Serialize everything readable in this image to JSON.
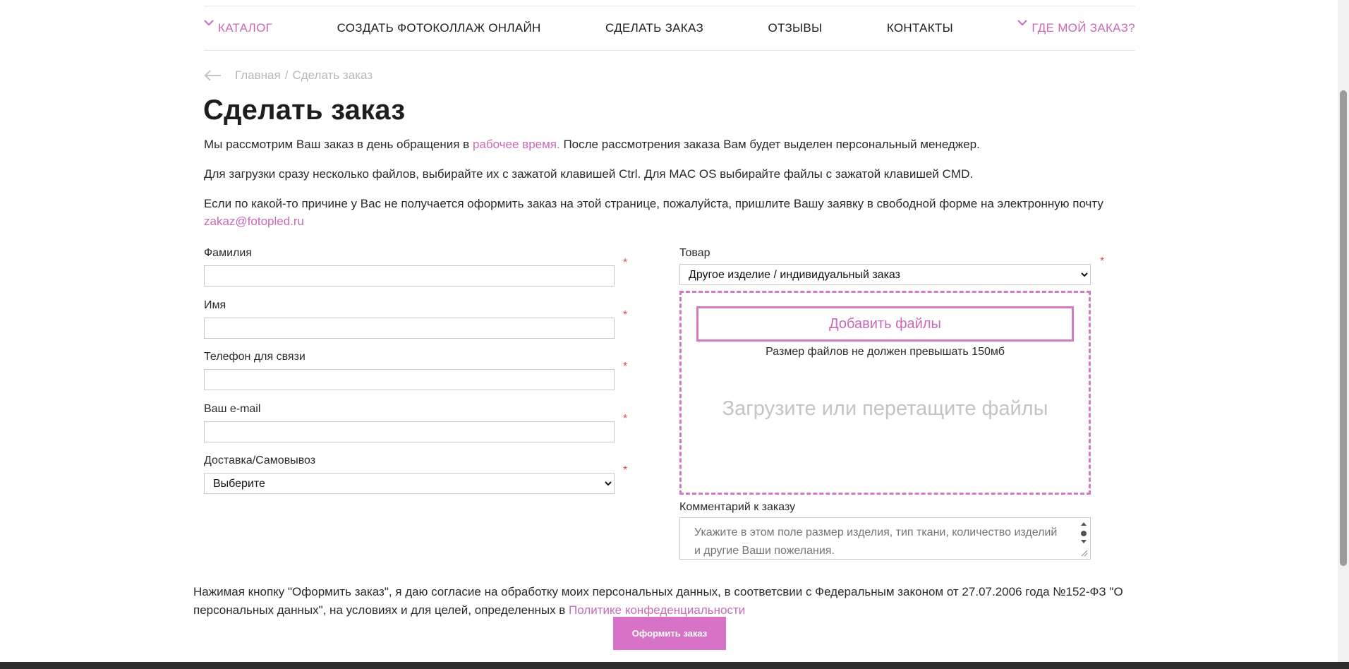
{
  "nav": {
    "catalog": "КАТАЛОГ",
    "collage": "СОЗДАТЬ ФОТОКОЛЛАЖ ОНЛАЙН",
    "order": "СДЕЛАТЬ ЗАКАЗ",
    "reviews": "ОТЗЫВЫ",
    "contacts": "КОНТАКТЫ",
    "where": "ГДЕ МОЙ ЗАКАЗ?"
  },
  "breadcrumb": {
    "home": "Главная",
    "separator": "/",
    "current": "Сделать заказ"
  },
  "page": {
    "title": "Сделать заказ"
  },
  "intro": {
    "p1_before": "Мы рассмотрим Ваш заказ в день обращения в ",
    "p1_link": "рабочее время.",
    "p1_after": " После рассмотрения заказа Вам будет выделен персональный менеджер.",
    "p2": "Для загрузки сразу несколько файлов, выбирайте их с зажатой клавишей Ctrl. Для MAC OS выбирайте файлы с зажатой клавишей CMD.",
    "p3_before": "Если по какой-то причине у Вас не получается оформить заказ на этой странице, пожалуйста, пришлите Вашу заявку в свободной форме на электронную почту ",
    "p3_link": "zakaz@fotopled.ru"
  },
  "form": {
    "required_mark": "*",
    "surname_label": "Фамилия",
    "name_label": "Имя",
    "phone_label": "Телефон для связи",
    "email_label": "Ваш e-mail",
    "delivery_label": "Доставка/Самовывоз",
    "delivery_value": "Выберите",
    "product_label": "Товар",
    "product_value": "Другое изделие / индивидуальный заказ",
    "add_files": "Добавить файлы",
    "size_note": "Размер файлов не должен превышать 150мб",
    "drop_text": "Загрузите или перетащите файлы",
    "comment_label": "Комментарий к заказу",
    "comment_placeholder": "Укажите в этом поле размер изделия, тип ткани, количество изделий и другие Ваши пожелания."
  },
  "consent": {
    "text": "Нажимая кнопку \"Оформить заказ\", я даю согласие на обработку моих персональных данных, в соответсвии с Федеральным законом от 27.07.2006 года №152-ФЗ \"О персональных данных\", на условиях и для целей, определенных в ",
    "link": "Политике конфеденциальности"
  },
  "submit": {
    "label": "Оформить заказ"
  },
  "colors": {
    "accent": "#c86ab6",
    "button": "#d872c6",
    "required": "#d2504c"
  }
}
